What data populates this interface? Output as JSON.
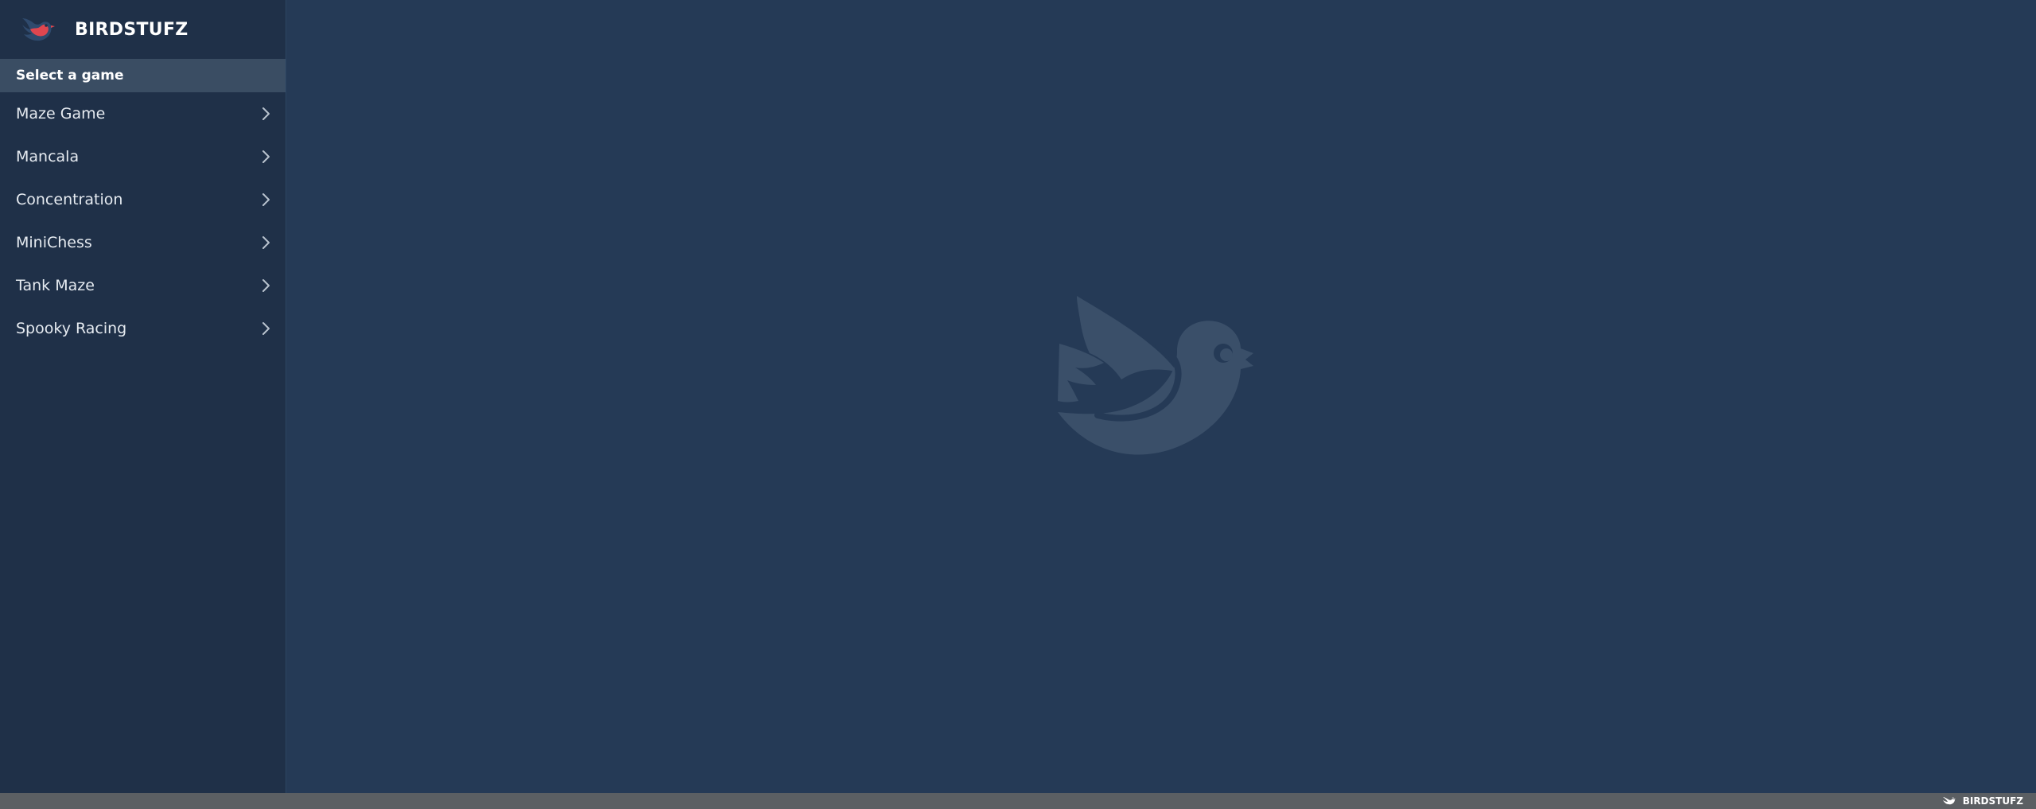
{
  "app": {
    "brand_name": "BIRDSTUFZ",
    "logo_icon": "bird-logo-icon"
  },
  "sidebar": {
    "section_title": "Select a game",
    "items": [
      {
        "label": "Maze Game",
        "icon": "chevron-right-icon"
      },
      {
        "label": "Mancala",
        "icon": "chevron-right-icon"
      },
      {
        "label": "Concentration",
        "icon": "chevron-right-icon"
      },
      {
        "label": "MiniChess",
        "icon": "chevron-right-icon"
      },
      {
        "label": "Tank Maze",
        "icon": "chevron-right-icon"
      },
      {
        "label": "Spooky Racing",
        "icon": "chevron-right-icon"
      }
    ]
  },
  "main": {
    "watermark_icon": "bird-watermark-icon"
  },
  "footer": {
    "brand_name": "BIRDSTUFZ",
    "logo_icon": "bird-small-icon"
  },
  "colors": {
    "sidebar_bg": "#1f3048",
    "main_bg": "#253a56",
    "section_header_bg": "#3a4d63",
    "footer_bg": "#5b5f63",
    "logo_accent": "#e0464f",
    "watermark": "#3a4f69"
  }
}
